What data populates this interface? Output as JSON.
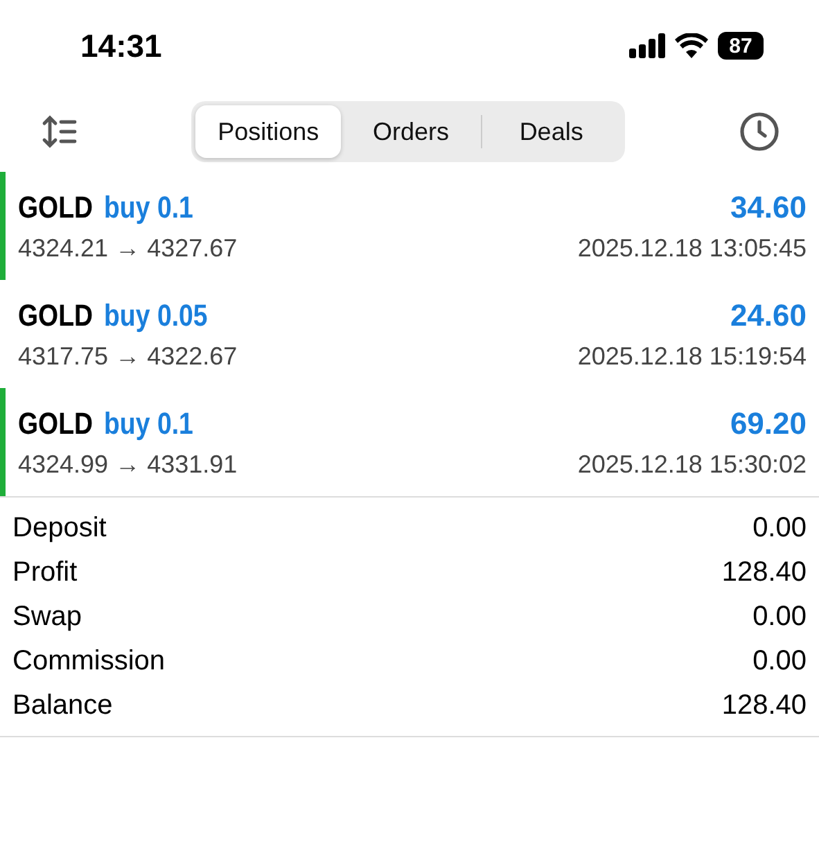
{
  "status_bar": {
    "time": "14:31",
    "battery": "87"
  },
  "tabs": [
    {
      "label": "Positions",
      "selected": true
    },
    {
      "label": "Orders",
      "selected": false
    },
    {
      "label": "Deals",
      "selected": false
    }
  ],
  "deals": [
    {
      "symbol": "GOLD",
      "side": "buy 0.1",
      "profit": "34.60",
      "prices": "4324.21 → 4327.67",
      "time": "2025.12.18 13:05:45",
      "marked": true
    },
    {
      "symbol": "GOLD",
      "side": "buy 0.05",
      "profit": "24.60",
      "prices": "4317.75 → 4322.67",
      "time": "2025.12.18 15:19:54",
      "marked": false
    },
    {
      "symbol": "GOLD",
      "side": "buy 0.1",
      "profit": "69.20",
      "prices": "4324.99 → 4331.91",
      "time": "2025.12.18 15:30:02",
      "marked": true
    }
  ],
  "summary": [
    {
      "label": "Deposit",
      "value": "0.00"
    },
    {
      "label": "Profit",
      "value": "128.40"
    },
    {
      "label": "Swap",
      "value": "0.00"
    },
    {
      "label": "Commission",
      "value": "0.00"
    },
    {
      "label": "Balance",
      "value": "128.40"
    }
  ]
}
